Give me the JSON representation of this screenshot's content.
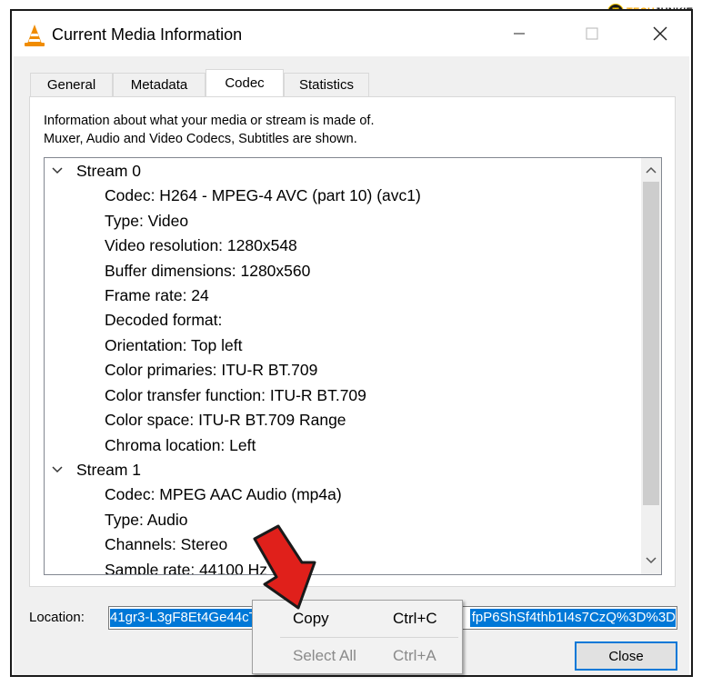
{
  "watermark": {
    "logo_letter": "T",
    "part1": "TECH",
    "part2": "JUNKIE"
  },
  "window": {
    "title": "Current Media Information",
    "icon": "vlc-cone-icon",
    "minimize_icon": "minimize-icon",
    "maximize_icon": "maximize-icon",
    "close_icon": "close-icon"
  },
  "tabs": [
    {
      "label": "General",
      "active": false
    },
    {
      "label": "Metadata",
      "active": false
    },
    {
      "label": "Codec",
      "active": true
    },
    {
      "label": "Statistics",
      "active": false
    }
  ],
  "codec": {
    "description_line1": "Information about what your media or stream is made of.",
    "description_line2": "Muxer, Audio and Video Codecs, Subtitles are shown.",
    "streams": [
      {
        "name": "Stream 0",
        "expanded": true,
        "items": [
          "Codec: H264 - MPEG-4 AVC (part 10) (avc1)",
          "Type: Video",
          "Video resolution: 1280x548",
          "Buffer dimensions: 1280x560",
          "Frame rate: 24",
          "Decoded format:",
          "Orientation: Top left",
          "Color primaries: ITU-R BT.709",
          "Color transfer function: ITU-R BT.709",
          "Color space: ITU-R BT.709 Range",
          "Chroma location: Left"
        ]
      },
      {
        "name": "Stream 1",
        "expanded": true,
        "items": [
          "Codec: MPEG AAC Audio (mp4a)",
          "Type: Audio",
          "Channels: Stereo",
          "Sample rate: 44100 Hz"
        ]
      }
    ]
  },
  "location": {
    "label": "Location:",
    "value_visible_left": "41gr3-L3gF8Et4Ge44cT",
    "value_visible_right": "fpP6ShSf4thb1I4s7CzQ%3D%3D"
  },
  "close_button": {
    "label": "Close"
  },
  "context_menu": {
    "items": [
      {
        "label": "Copy",
        "shortcut": "Ctrl+C",
        "enabled": true
      },
      {
        "label": "Select All",
        "shortcut": "Ctrl+A",
        "enabled": false
      }
    ]
  },
  "colors": {
    "selection": "#0078d7",
    "arrow": "#e0201b",
    "dialog_bg": "#f0f0f0"
  }
}
